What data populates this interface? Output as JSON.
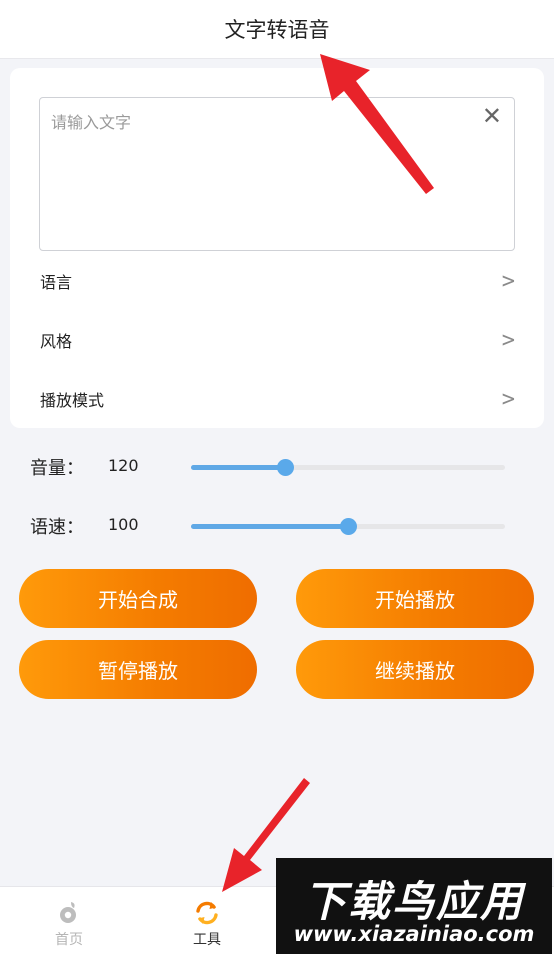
{
  "header": {
    "title": "文字转语音"
  },
  "input": {
    "placeholder": "请输入文字",
    "clear_icon": "close-icon"
  },
  "settings": [
    {
      "label": "语言",
      "chevron": ">"
    },
    {
      "label": "风格",
      "chevron": ">"
    },
    {
      "label": "播放模式",
      "chevron": ">"
    }
  ],
  "sliders": {
    "volume": {
      "label": "音量：",
      "value": "120",
      "fraction": 0.3
    },
    "speed": {
      "label": "语速：",
      "value": "100",
      "fraction": 0.5
    }
  },
  "buttons": {
    "start_synthesis": "开始合成",
    "start_play": "开始播放",
    "pause_play": "暂停播放",
    "resume_play": "继续播放"
  },
  "tabbar": {
    "home": {
      "label": "首页",
      "icon": "home-icon"
    },
    "tools": {
      "label": "工具",
      "icon": "refresh-icon"
    }
  },
  "watermark": {
    "title": "下载鸟应用",
    "url": "www.xiazainiao.com"
  },
  "colors": {
    "accent": "#f47b00",
    "slider": "#5aa9ea",
    "arrow": "#e8232a",
    "inactive": "#b5b5b5"
  }
}
